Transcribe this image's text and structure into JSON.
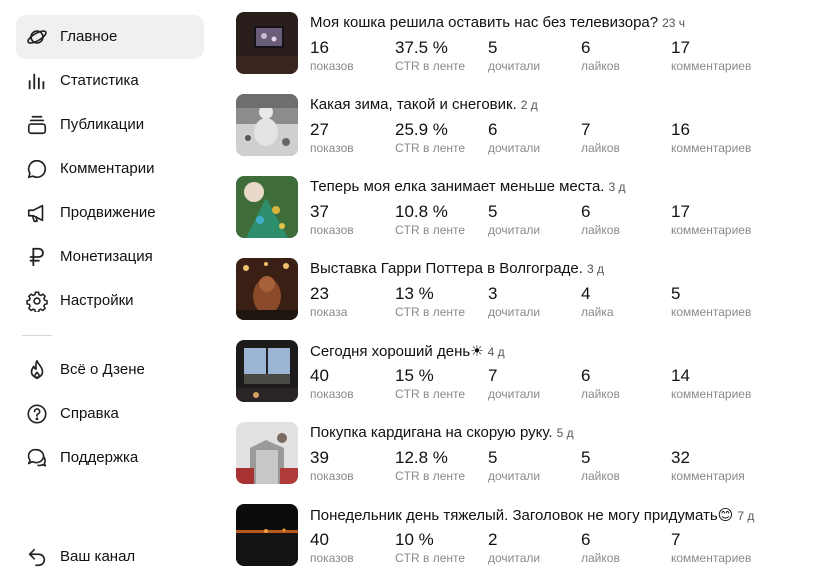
{
  "sidebar": {
    "items": [
      {
        "label": "Главное",
        "icon": "planet-icon"
      },
      {
        "label": "Статистика",
        "icon": "bar-chart-icon"
      },
      {
        "label": "Публикации",
        "icon": "stack-icon"
      },
      {
        "label": "Комментарии",
        "icon": "comment-icon"
      },
      {
        "label": "Продвижение",
        "icon": "megaphone-icon"
      },
      {
        "label": "Монетизация",
        "icon": "ruble-icon"
      },
      {
        "label": "Настройки",
        "icon": "gear-icon"
      }
    ],
    "secondary": [
      {
        "label": "Всё о Дзене",
        "icon": "flame-icon"
      },
      {
        "label": "Справка",
        "icon": "question-icon"
      },
      {
        "label": "Поддержка",
        "icon": "chat-icon"
      }
    ],
    "channel_label": "Ваш канал"
  },
  "posts": [
    {
      "title": "Моя кошка решила оставить нас без телевизора?",
      "age": "23 ч",
      "stats": [
        {
          "v": "16",
          "c": "показов"
        },
        {
          "v": "37.5 %",
          "c": "CTR в ленте"
        },
        {
          "v": "5",
          "c": "дочитали"
        },
        {
          "v": "6",
          "c": "лайков"
        },
        {
          "v": "17",
          "c": "комментариев"
        }
      ]
    },
    {
      "title": "Какая зима, такой и снеговик.",
      "age": "2 д",
      "stats": [
        {
          "v": "27",
          "c": "показов"
        },
        {
          "v": "25.9 %",
          "c": "CTR в ленте"
        },
        {
          "v": "6",
          "c": "дочитали"
        },
        {
          "v": "7",
          "c": "лайков"
        },
        {
          "v": "16",
          "c": "комментариев"
        }
      ]
    },
    {
      "title": "Теперь моя елка занимает меньше места.",
      "age": "3 д",
      "stats": [
        {
          "v": "37",
          "c": "показов"
        },
        {
          "v": "10.8 %",
          "c": "CTR в ленте"
        },
        {
          "v": "5",
          "c": "дочитали"
        },
        {
          "v": "6",
          "c": "лайков"
        },
        {
          "v": "17",
          "c": "комментариев"
        }
      ]
    },
    {
      "title": "Выставка Гарри Поттера в Волгограде.",
      "age": "3 д",
      "stats": [
        {
          "v": "23",
          "c": "показа"
        },
        {
          "v": "13 %",
          "c": "CTR в ленте"
        },
        {
          "v": "3",
          "c": "дочитали"
        },
        {
          "v": "4",
          "c": "лайка"
        },
        {
          "v": "5",
          "c": "комментариев"
        }
      ]
    },
    {
      "title": "Сегодня хороший день☀",
      "age": "4 д",
      "stats": [
        {
          "v": "40",
          "c": "показов"
        },
        {
          "v": "15 %",
          "c": "CTR в ленте"
        },
        {
          "v": "7",
          "c": "дочитали"
        },
        {
          "v": "6",
          "c": "лайков"
        },
        {
          "v": "14",
          "c": "комментариев"
        }
      ]
    },
    {
      "title": "Покупка кардигана на скорую руку.",
      "age": "5 д",
      "stats": [
        {
          "v": "39",
          "c": "показов"
        },
        {
          "v": "12.8 %",
          "c": "CTR в ленте"
        },
        {
          "v": "5",
          "c": "дочитали"
        },
        {
          "v": "5",
          "c": "лайков"
        },
        {
          "v": "32",
          "c": "комментария"
        }
      ]
    },
    {
      "title": "Понедельник день тяжелый. Заголовок не могу придумать😊",
      "age": "7 д",
      "stats": [
        {
          "v": "40",
          "c": "показов"
        },
        {
          "v": "10 %",
          "c": "CTR в ленте"
        },
        {
          "v": "2",
          "c": "дочитали"
        },
        {
          "v": "6",
          "c": "лайков"
        },
        {
          "v": "7",
          "c": "комментариев"
        }
      ]
    }
  ]
}
